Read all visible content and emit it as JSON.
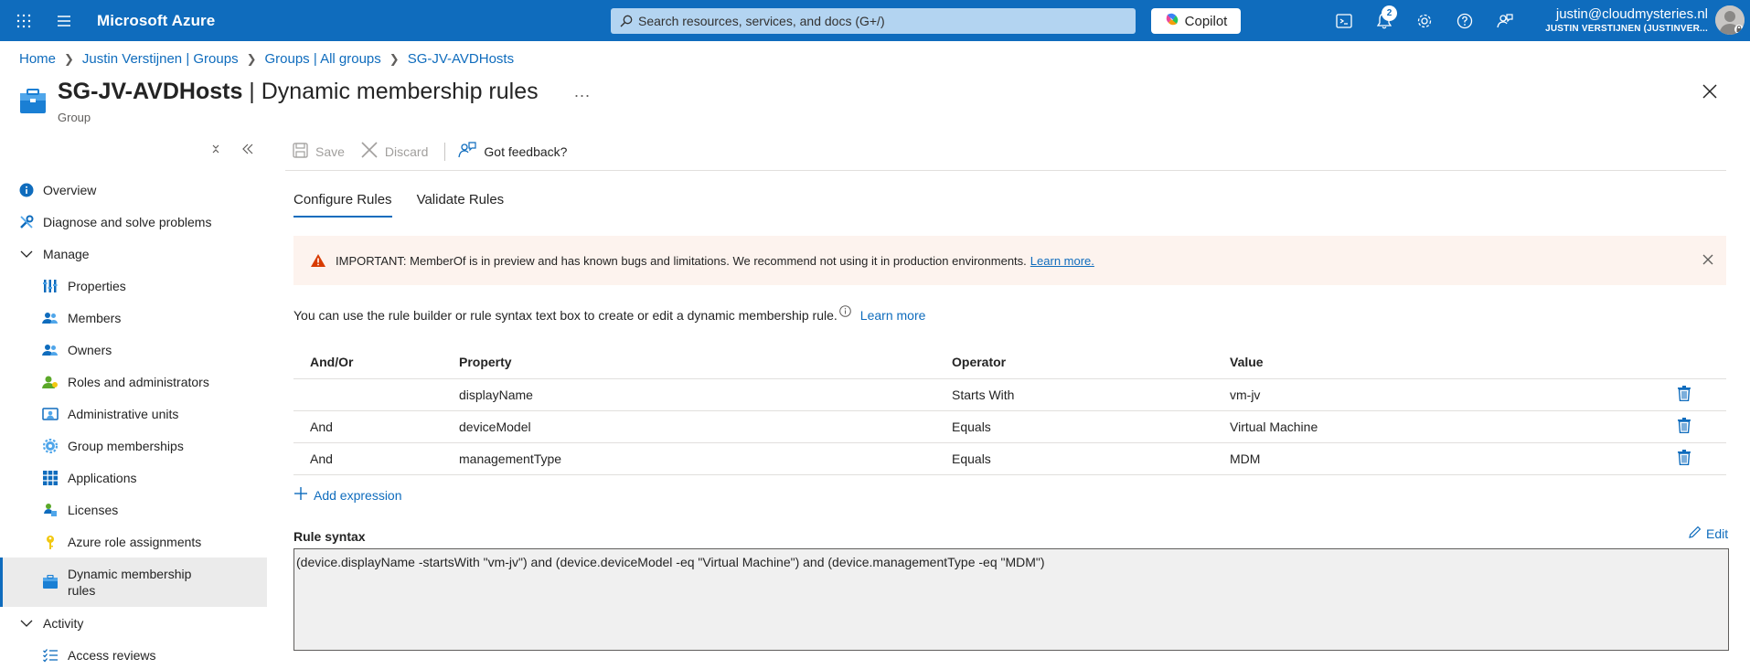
{
  "header": {
    "brand": "Microsoft Azure",
    "search_placeholder": "Search resources, services, and docs (G+/)",
    "copilot_label": "Copilot",
    "notification_count": "2",
    "account_email": "justin@cloudmysteries.nl",
    "account_org": "JUSTIN VERSTIJNEN (JUSTINVER..."
  },
  "breadcrumb": [
    "Home",
    "Justin Verstijnen | Groups",
    "Groups | All groups",
    "SG-JV-AVDHosts"
  ],
  "page": {
    "title_name": "SG-JV-AVDHosts",
    "title_rest": " | Dynamic membership rules",
    "subtitle": "Group",
    "more": "..."
  },
  "sidebar": {
    "items": [
      {
        "label": "Overview",
        "icon": "info-icon",
        "level": "top"
      },
      {
        "label": "Diagnose and solve problems",
        "icon": "wrench-icon",
        "level": "top"
      },
      {
        "label": "Manage",
        "icon": "chevron-down-icon",
        "level": "top"
      },
      {
        "label": "Properties",
        "icon": "properties-icon",
        "level": "sub"
      },
      {
        "label": "Members",
        "icon": "members-icon",
        "level": "sub"
      },
      {
        "label": "Owners",
        "icon": "owners-icon",
        "level": "sub"
      },
      {
        "label": "Roles and administrators",
        "icon": "roles-icon",
        "level": "sub"
      },
      {
        "label": "Administrative units",
        "icon": "admin-units-icon",
        "level": "sub"
      },
      {
        "label": "Group memberships",
        "icon": "gear-icon",
        "level": "sub"
      },
      {
        "label": "Applications",
        "icon": "apps-grid-icon",
        "level": "sub"
      },
      {
        "label": "Licenses",
        "icon": "licenses-icon",
        "level": "sub"
      },
      {
        "label": "Azure role assignments",
        "icon": "key-icon",
        "level": "sub"
      },
      {
        "label": "Dynamic membership rules",
        "icon": "group-icon",
        "level": "sub",
        "active": true
      },
      {
        "label": "Activity",
        "icon": "chevron-down-icon",
        "level": "top"
      },
      {
        "label": "Access reviews",
        "icon": "checklist-icon",
        "level": "sub"
      }
    ]
  },
  "toolbar": {
    "save": "Save",
    "discard": "Discard",
    "feedback": "Got feedback?"
  },
  "tabs": [
    "Configure Rules",
    "Validate Rules"
  ],
  "banner": {
    "text": "IMPORTANT: MemberOf is in preview and has known bugs and limitations. We recommend not using it in production environments.",
    "link": "Learn more."
  },
  "info": {
    "text": "You can use the rule builder or rule syntax text box to create or edit a dynamic membership rule.",
    "link": "Learn more"
  },
  "rules_table": {
    "headers": [
      "And/Or",
      "Property",
      "Operator",
      "Value"
    ],
    "rows": [
      {
        "andor": "",
        "property": "displayName",
        "operator": "Starts With",
        "value": "vm-jv"
      },
      {
        "andor": "And",
        "property": "deviceModel",
        "operator": "Equals",
        "value": "Virtual Machine"
      },
      {
        "andor": "And",
        "property": "managementType",
        "operator": "Equals",
        "value": "MDM"
      }
    ]
  },
  "add_expression": "Add expression",
  "rule_syntax": {
    "label": "Rule syntax",
    "edit": "Edit",
    "text": "(device.displayName -startsWith \"vm-jv\") and (device.deviceModel -eq \"Virtual Machine\") and (device.managementType -eq \"MDM\")"
  },
  "colors": {
    "azure_blue": "#0f6cbd",
    "banner_bg": "#fdf3ee",
    "warning": "#d83b01"
  }
}
